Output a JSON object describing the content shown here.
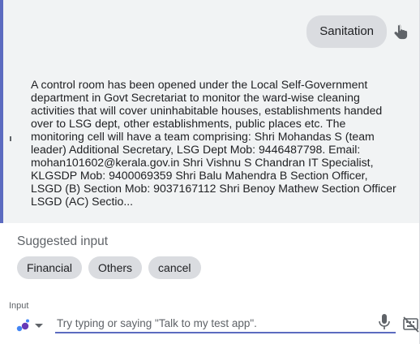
{
  "conversation": {
    "user_message": "Sanitation",
    "assistant_message": "A control room has been opened under the Local Self-Government department in Govt Secretariat to monitor the ward-wise cleaning activities that will cover uninhabitable houses, establishments handed over to LSG dept, other establishments, public places etc. The monitoring cell will have a team comprising: Shri Mohandas S (team leader) Additional Secretary, LSG Dept Mob: 9446487798. Email: mohan101602@kerala.gov.in Shri Vishnu S Chandran IT Specialist, KLGSDP Mob: 9400069359 Shri Balu Mahendra B Section Officer, LSGD (B) Section Mob: 9037167112 Shri Benoy Mathew Section Officer LSGD (AC) Sectio..."
  },
  "suggestions": {
    "title": "Suggested input",
    "chips": [
      {
        "label": "Financial"
      },
      {
        "label": "Others"
      },
      {
        "label": "cancel"
      }
    ]
  },
  "input": {
    "label": "Input",
    "placeholder": "Try typing or saying \"Talk to my test app\".",
    "value": ""
  },
  "icons": {
    "touch": "touch-icon",
    "assistant": "assistant-icon",
    "dropdown": "dropdown-arrow-icon",
    "mic": "mic-icon",
    "keyboard_off": "keyboard-off-icon"
  },
  "colors": {
    "accent": "#5c6bc0",
    "bubble": "#dadce0",
    "conversation_bg": "#f1f3f4",
    "assistant_blue": "#4285f4",
    "assistant_purple": "#673ab7"
  }
}
